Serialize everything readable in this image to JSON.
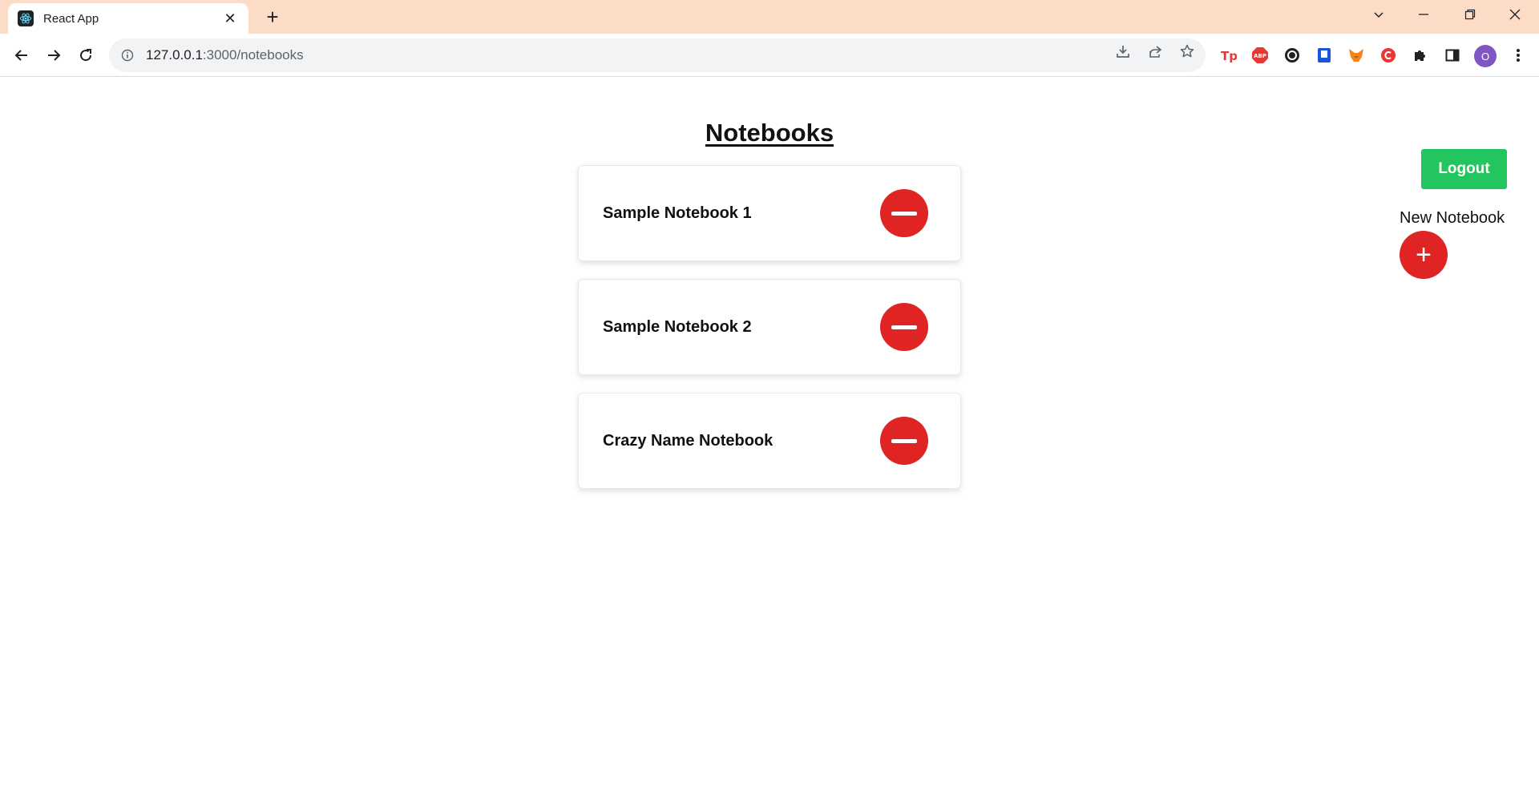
{
  "browser": {
    "tab_title": "React App",
    "url_host": "127.0.0.1",
    "url_path": ":3000/notebooks",
    "profile_initial": "O"
  },
  "page": {
    "title": "Notebooks",
    "logout_label": "Logout",
    "new_notebook_label": "New Notebook",
    "add_symbol": "+"
  },
  "notebooks": [
    {
      "name": "Sample Notebook 1"
    },
    {
      "name": "Sample Notebook 2"
    },
    {
      "name": "Crazy Name Notebook"
    }
  ],
  "colors": {
    "tabbar": "#fcdcc7",
    "danger": "#e02424",
    "success": "#22c55e"
  }
}
